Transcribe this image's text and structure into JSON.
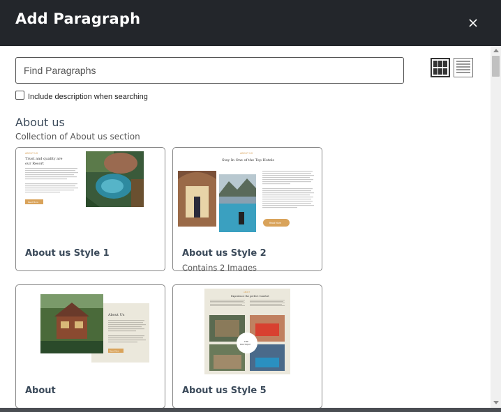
{
  "dialog": {
    "title": "Add Paragraph",
    "close_icon": "close-icon"
  },
  "search": {
    "placeholder": "Find Paragraphs",
    "value": ""
  },
  "view_toggle": {
    "grid_icon": "grid-view-icon",
    "list_icon": "list-view-icon",
    "selected": "grid"
  },
  "include_description": {
    "label": "Include description when searching",
    "checked": false
  },
  "section": {
    "title": "About us",
    "subtitle": "Collection of About us section"
  },
  "cards": [
    {
      "title": "About us Style 1",
      "subtitle": "",
      "thumb": {
        "kicker": "ABOUT US",
        "heading_line1": "Trust and quality are",
        "heading_line2": "our Resort",
        "button": "Read More"
      }
    },
    {
      "title": "About us Style 2",
      "subtitle": "Contains 2 Images",
      "thumb": {
        "kicker": "ABOUT US",
        "heading": "Stay In One of the Top Hotels",
        "button": "Read More"
      }
    },
    {
      "title": "About",
      "subtitle": "",
      "thumb": {
        "heading": "About Us",
        "button": "Read More"
      }
    },
    {
      "title": "About us Style 5",
      "subtitle": "",
      "thumb": {
        "kicker": "ABOUT",
        "heading": "Experience the perfect Comfort",
        "badge_line1": "THE",
        "badge_line2": "BOUTIQUE"
      }
    }
  ],
  "colors": {
    "header_bg": "#23262b",
    "accent_gold": "#d9a35a",
    "title_text": "#3b4a5a"
  }
}
